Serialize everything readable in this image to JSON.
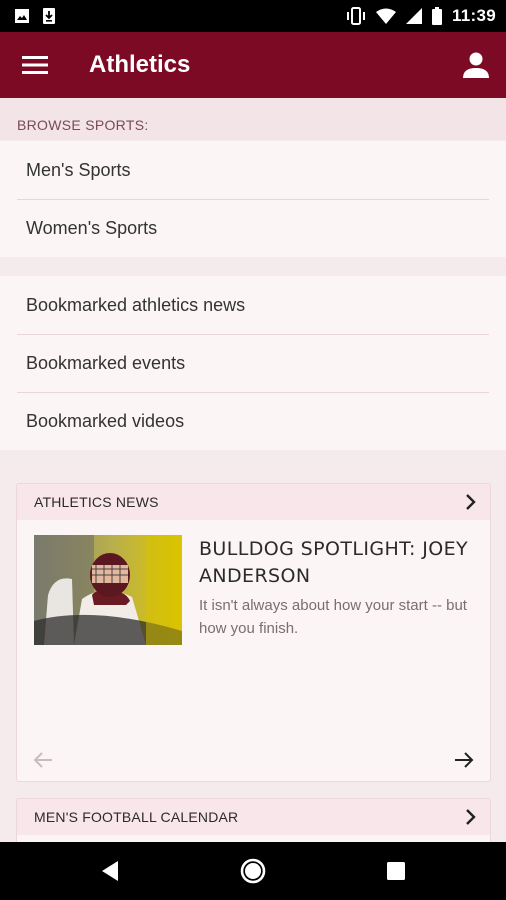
{
  "status_bar": {
    "time": "11:39",
    "icons": [
      "image-icon",
      "download-icon",
      "vibrate-icon",
      "wifi-icon",
      "signal-icon",
      "battery-icon"
    ]
  },
  "app_bar": {
    "title": "Athletics",
    "menu_icon": "hamburger-menu-icon",
    "account_icon": "person-icon"
  },
  "browse": {
    "label": "BROWSE SPORTS:",
    "items": [
      {
        "label": "Men's Sports"
      },
      {
        "label": "Women's Sports"
      }
    ]
  },
  "bookmarks": {
    "items": [
      {
        "label": "Bookmarked athletics news"
      },
      {
        "label": "Bookmarked events"
      },
      {
        "label": "Bookmarked videos"
      }
    ]
  },
  "news_card": {
    "header": "ATHLETICS NEWS",
    "article": {
      "title": "BULLDOG SPOTLIGHT: JOEY ANDERSON",
      "summary": "It isn't always about how your start -- but how you finish."
    }
  },
  "calendar_card": {
    "header": "MEN'S FOOTBALL CALENDAR"
  },
  "colors": {
    "brand": "#7c0a24",
    "background": "#f5eaec",
    "card_header": "#f8e6ea"
  }
}
